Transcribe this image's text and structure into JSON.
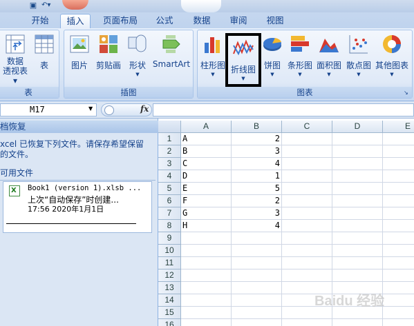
{
  "tabs": [
    "开始",
    "插入",
    "页面布局",
    "公式",
    "数据",
    "审阅",
    "视图"
  ],
  "active_tab": "插入",
  "ribbon": {
    "groups": {
      "tables": {
        "title": "表",
        "buttons": [
          "数据\n透视表",
          "表"
        ]
      },
      "illustrations": {
        "title": "插图",
        "buttons": [
          "图片",
          "剪贴画",
          "形状",
          "SmartArt"
        ]
      },
      "charts": {
        "title": "图表",
        "buttons": [
          "柱形图",
          "折线图",
          "饼图",
          "条形图",
          "面积图",
          "散点图",
          "其他图表"
        ]
      }
    },
    "labels": {
      "pivot_a": "数据",
      "pivot_b": "透视表 ▾",
      "table": "表",
      "picture": "图片",
      "clipart": "剪贴画",
      "shapes": "形状",
      "smartart": "SmartArt",
      "column": "柱形图",
      "line": "折线图",
      "pie": "饼图",
      "bar": "条形图",
      "area": "面积图",
      "scatter": "散点图",
      "other": "其他图表",
      "tables_group": "表",
      "illustrations_group": "插图",
      "charts_group": "图表"
    }
  },
  "formula_bar": {
    "name_box": "M17",
    "fx": "fx",
    "formula": ""
  },
  "recovery": {
    "title": "档恢复",
    "message_line1": "xcel 已恢复下列文件。请保存希望保留",
    "message_line2": "的文件。",
    "available_label": "可用文件",
    "file": {
      "name": "Book1 (version 1).xlsb ...",
      "status": "上次“自动保存”时创建...",
      "time": "17:56 2020年1月1日",
      "icon": "excel-file-icon"
    }
  },
  "sheet": {
    "columns": [
      "A",
      "B",
      "C",
      "D",
      "E"
    ],
    "rows": [
      "1",
      "2",
      "3",
      "4",
      "5",
      "6",
      "7",
      "8",
      "9",
      "10",
      "11",
      "12",
      "13",
      "14",
      "15",
      "16"
    ],
    "data": [
      [
        "A",
        "2"
      ],
      [
        "B",
        "3"
      ],
      [
        "C",
        "4"
      ],
      [
        "D",
        "1"
      ],
      [
        "E",
        "5"
      ],
      [
        "F",
        "2"
      ],
      [
        "G",
        "3"
      ],
      [
        "H",
        "4"
      ]
    ]
  },
  "watermark": "Baidu 经验"
}
